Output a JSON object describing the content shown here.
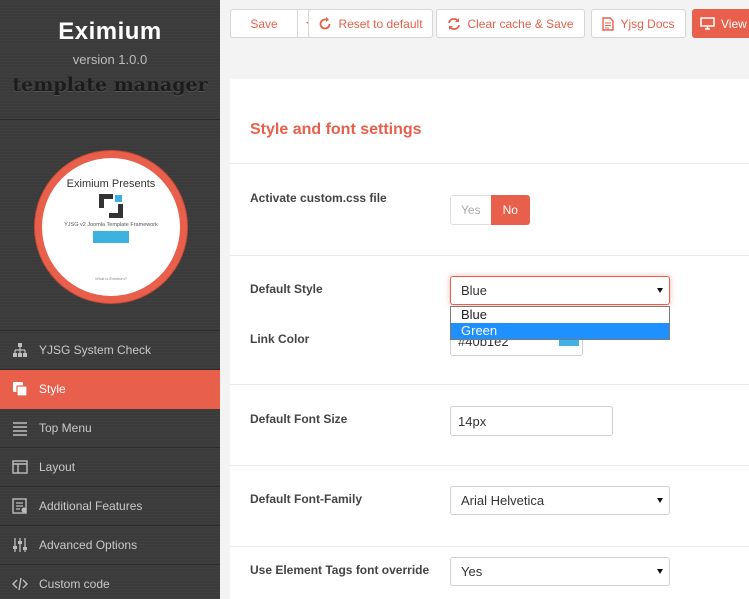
{
  "brand": {
    "name": "Eximium",
    "version": "version 1.0.0",
    "subtitle": "template manager"
  },
  "logo_preview": {
    "title": "Eximium Presents",
    "tagline": "YJSG v2 Joomla Template Framework",
    "footer": "What is Eximium?"
  },
  "sidebar": {
    "items": [
      {
        "label": "YJSG System Check",
        "icon": "sitemap-icon"
      },
      {
        "label": "Style",
        "icon": "style-icon",
        "active": true
      },
      {
        "label": "Top Menu",
        "icon": "menu-list-icon"
      },
      {
        "label": "Layout",
        "icon": "layout-icon"
      },
      {
        "label": "Additional Features",
        "icon": "features-icon"
      },
      {
        "label": "Advanced Options",
        "icon": "sliders-icon"
      },
      {
        "label": "Custom code",
        "icon": "code-icon"
      }
    ]
  },
  "toolbar": {
    "save_label": "Save",
    "reset_label": "Reset to default",
    "clear_label": "Clear cache & Save",
    "docs_label": "Yjsg Docs",
    "view_label": "View"
  },
  "section": {
    "title": "Style and font settings"
  },
  "fields": {
    "custom_css": {
      "label": "Activate custom.css file",
      "yes": "Yes",
      "no": "No",
      "selected": "No"
    },
    "default_style": {
      "label": "Default Style",
      "value": "Blue",
      "options": [
        "Blue",
        "Green"
      ],
      "highlighted": "Green"
    },
    "link_color": {
      "label": "Link Color",
      "value": "#40b1e2"
    },
    "font_size": {
      "label": "Default Font Size",
      "value": "14px"
    },
    "font_family": {
      "label": "Default Font-Family",
      "value": "Arial Helvetica"
    },
    "tags_override": {
      "label": "Use Element Tags font override",
      "value": "Yes"
    }
  },
  "colors": {
    "accent": "#e8604c",
    "sidebar_bg": "#3b3b3b",
    "link_swatch": "#40b1e2",
    "highlight": "#1e90ff"
  }
}
